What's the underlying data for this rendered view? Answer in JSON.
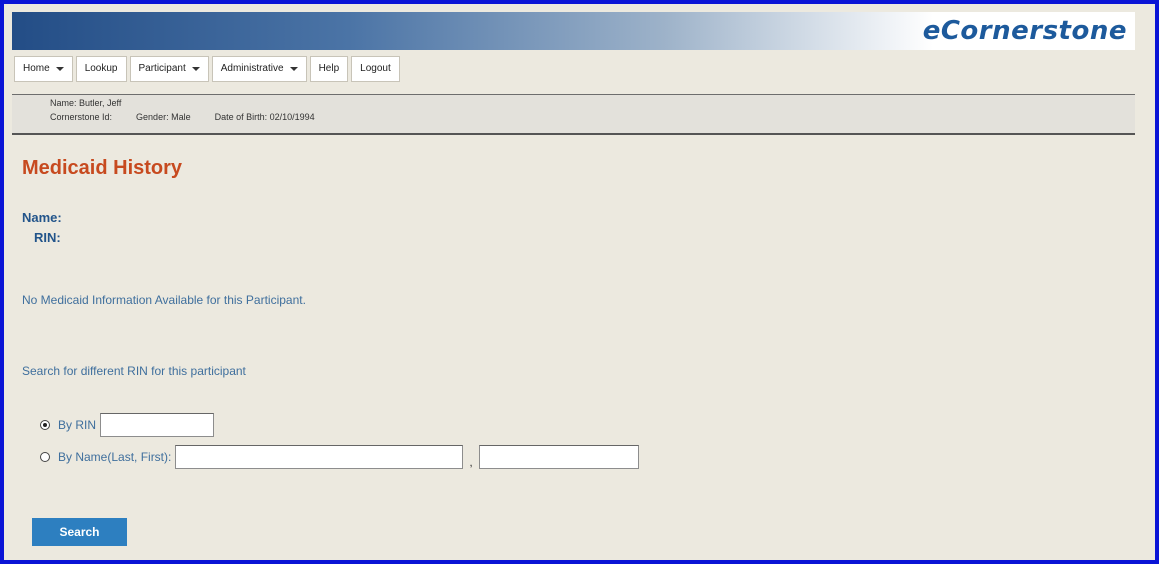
{
  "app": {
    "logo_text": "eCornerstone"
  },
  "nav": {
    "items": [
      {
        "label": "Home",
        "dropdown": true
      },
      {
        "label": "Lookup",
        "dropdown": false
      },
      {
        "label": "Participant",
        "dropdown": true
      },
      {
        "label": "Administrative",
        "dropdown": true
      },
      {
        "label": "Help",
        "dropdown": false
      },
      {
        "label": "Logout",
        "dropdown": false
      }
    ]
  },
  "participant": {
    "name": "Name: Butler, Jeff",
    "cornerstone_id": "Cornerstone Id:",
    "gender": "Gender: Male",
    "dob": "Date of Birth: 02/10/1994"
  },
  "page": {
    "title": "Medicaid History",
    "name_label": "Name:",
    "rin_label": "RIN:",
    "no_info_message": "No Medicaid Information Available for this Participant.",
    "search_prompt": "Search for different RIN for this participant"
  },
  "search": {
    "by_rin_label": "By RIN",
    "by_rin_selected": true,
    "by_rin_value": "",
    "by_name_label": "By Name(Last, First):",
    "by_name_selected": false,
    "last_name_value": "",
    "comma": ",",
    "first_name_value": "",
    "button_label": "Search"
  },
  "colors": {
    "frame_border": "#0a14d6",
    "page_background": "#ece9df",
    "title": "#c74a1f",
    "label": "#22548a",
    "text": "#3f6f9d",
    "button": "#2d7fc0"
  }
}
